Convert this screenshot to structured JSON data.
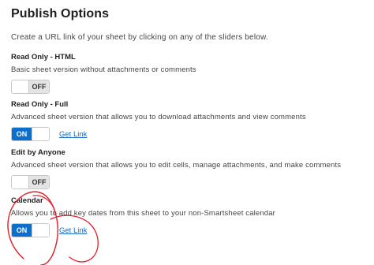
{
  "page": {
    "title": "Publish Options",
    "intro": "Create a URL link of your sheet by clicking on any of the sliders below."
  },
  "sections": [
    {
      "label": "Read Only - HTML",
      "description": "Basic sheet version without attachments or comments",
      "toggle_state": "OFF"
    },
    {
      "label": "Read Only - Full",
      "description": "Advanced sheet version that allows you to download attachments and view comments",
      "toggle_state": "ON",
      "link_label": "Get Link"
    },
    {
      "label": "Edit by Anyone",
      "description": "Advanced sheet version that allows you to edit cells, manage attachments, and make comments",
      "toggle_state": "OFF"
    },
    {
      "label": "Calendar",
      "description": "Allows you to add key dates from this sheet to your non-Smartsheet calendar",
      "toggle_state": "ON",
      "link_label": "Get Link"
    }
  ],
  "colors": {
    "toggle_on": "#0b6fcd",
    "toggle_off": "#e4e4e4",
    "link": "#1b67c2",
    "annotation": "#e0202a"
  }
}
